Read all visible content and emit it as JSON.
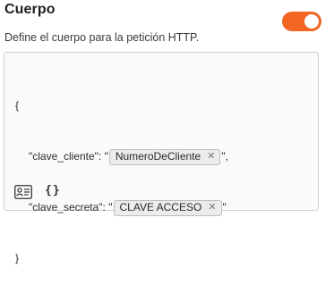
{
  "header": {
    "title": "Cuerpo",
    "toggle_on": true,
    "accent_color": "#f26522"
  },
  "description": "Define el cuerpo para la petición HTTP.",
  "editor": {
    "lines": {
      "open_brace": "{",
      "line1_prefix": "\"clave_cliente\": \"",
      "line1_suffix": "\",",
      "line2_prefix": "\"clave_secreta\": \"",
      "line2_suffix": "\"",
      "close_brace": "}"
    },
    "tags": {
      "tag1": "NumeroDeCliente",
      "tag2": "CLAVE ACCESO",
      "remove_glyph": "✕"
    },
    "toolbar": {
      "insert_variable_icon": "id-card-icon",
      "format_json_icon": "braces-icon",
      "braces_glyph": "{}"
    }
  }
}
